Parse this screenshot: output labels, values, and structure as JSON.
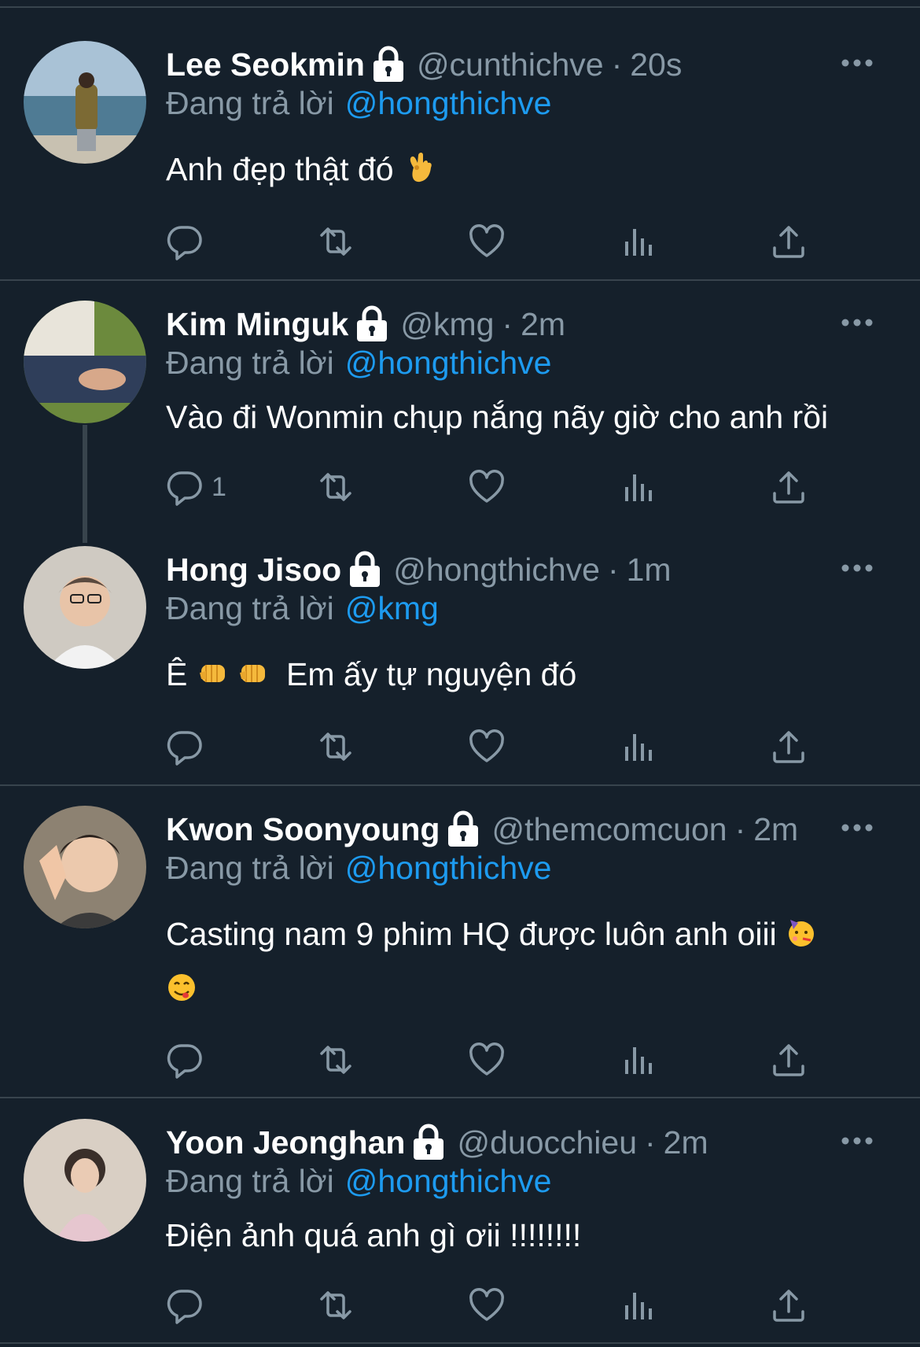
{
  "colors": {
    "background": "#15202b",
    "divider": "#38444d",
    "muted": "#8899a6",
    "link": "#1d9bf0"
  },
  "reply_label": "Đang trả lời",
  "tweets": [
    {
      "name": "Lee Seokmin",
      "handle": "@cunthichve",
      "sep": "·",
      "time": "20s",
      "reply_to": "@hongthichve",
      "text": "Anh đẹp thật đó",
      "emojis": [
        "ok-hand"
      ],
      "reply_count": ""
    },
    {
      "name": "Kim Minguk",
      "handle": "@kmg",
      "sep": "·",
      "time": "2m",
      "reply_to": "@hongthichve",
      "text": "Vào đi Wonmin chụp nắng nãy giờ cho anh rồi",
      "emojis": [],
      "reply_count": "1"
    },
    {
      "name": "Hong Jisoo",
      "handle": "@hongthichve",
      "sep": "·",
      "time": "1m",
      "reply_to": "@kmg",
      "text_prefix": "Ê",
      "text": "Em ấy tự nguyện đó",
      "emojis": [
        "fist-bump",
        "fist-bump"
      ],
      "reply_count": ""
    },
    {
      "name": "Kwon Soonyoung",
      "handle": "@themcomcuon",
      "sep": "·",
      "time": "2m",
      "reply_to": "@hongthichve",
      "text": "Casting nam 9 phim HQ được luôn anh oiii",
      "emojis": [
        "partying-face",
        "yum-face"
      ],
      "reply_count": ""
    },
    {
      "name": "Yoon Jeonghan",
      "handle": "@duocchieu",
      "sep": "·",
      "time": "2m",
      "reply_to": "@hongthichve",
      "text": "Điện ảnh quá anh gì ơii !!!!!!!!",
      "emojis": [],
      "reply_count": ""
    }
  ],
  "action_icons": [
    "reply-icon",
    "retweet-icon",
    "like-icon",
    "analytics-icon",
    "share-icon"
  ]
}
